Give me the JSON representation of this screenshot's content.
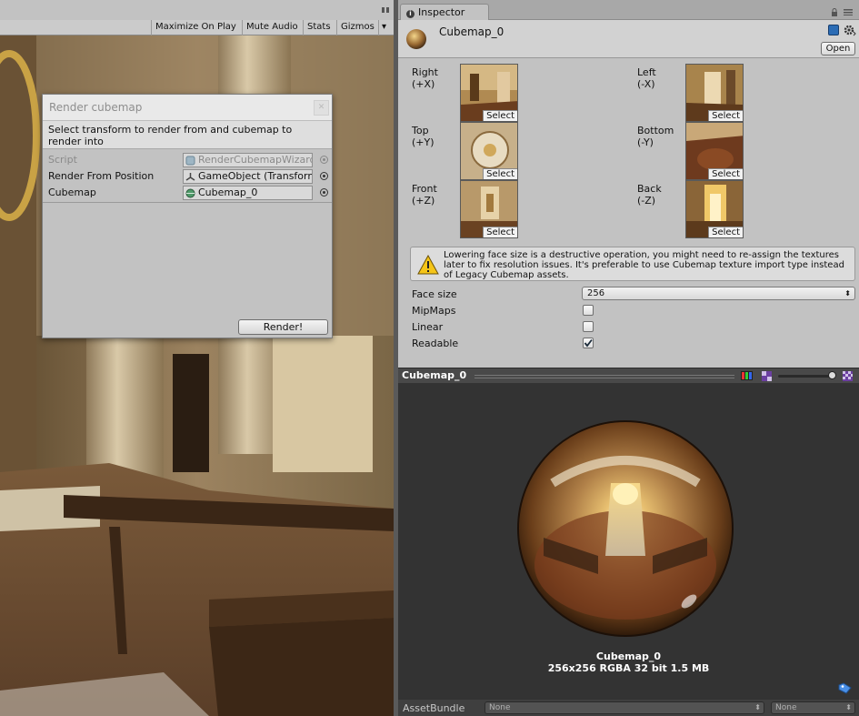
{
  "game": {
    "toolbar": {
      "maximize": "Maximize On Play",
      "mute": "Mute Audio",
      "stats": "Stats",
      "gizmos": "Gizmos"
    }
  },
  "wizard": {
    "title": "Render cubemap",
    "help_text": "Select transform to render from and cubemap to render into",
    "fields": [
      {
        "label": "Script",
        "value": "RenderCubemapWizard"
      },
      {
        "label": "Render From Position",
        "value": "GameObject (Transform)"
      },
      {
        "label": "Cubemap",
        "value": "Cubemap_0"
      }
    ],
    "render_button": "Render!"
  },
  "inspector": {
    "tab_label": "Inspector",
    "asset_name": "Cubemap_0",
    "open_button": "Open",
    "faces": [
      {
        "name": "Right",
        "axis": "(+X)",
        "select": "Select"
      },
      {
        "name": "Left",
        "axis": "(-X)",
        "select": "Select"
      },
      {
        "name": "Top",
        "axis": "(+Y)",
        "select": "Select"
      },
      {
        "name": "Bottom",
        "axis": "(-Y)",
        "select": "Select"
      },
      {
        "name": "Front",
        "axis": "(+Z)",
        "select": "Select"
      },
      {
        "name": "Back",
        "axis": "(-Z)",
        "select": "Select"
      }
    ],
    "warning": "Lowering face size is a destructive operation, you might need to re-assign the textures later to fix resolution issues. It's preferable to use Cubemap texture import type instead of Legacy Cubemap assets.",
    "properties": {
      "face_size_label": "Face size",
      "face_size_value": "256",
      "mipmaps_label": "MipMaps",
      "mipmaps_checked": false,
      "linear_label": "Linear",
      "linear_checked": false,
      "readable_label": "Readable",
      "readable_checked": true
    }
  },
  "preview": {
    "title": "Cubemap_0",
    "caption_name": "Cubemap_0",
    "caption_info": "256x256  RGBA 32 bit   1.5 MB",
    "assetbundle_label": "AssetBundle",
    "assetbundle_value": "None",
    "variant_value": "None"
  },
  "colors": {
    "panel_bg": "#c2c2c2",
    "preview_bg": "#333333",
    "header_bg": "#d2d2d2",
    "accent_blue": "#2b6cb5"
  }
}
